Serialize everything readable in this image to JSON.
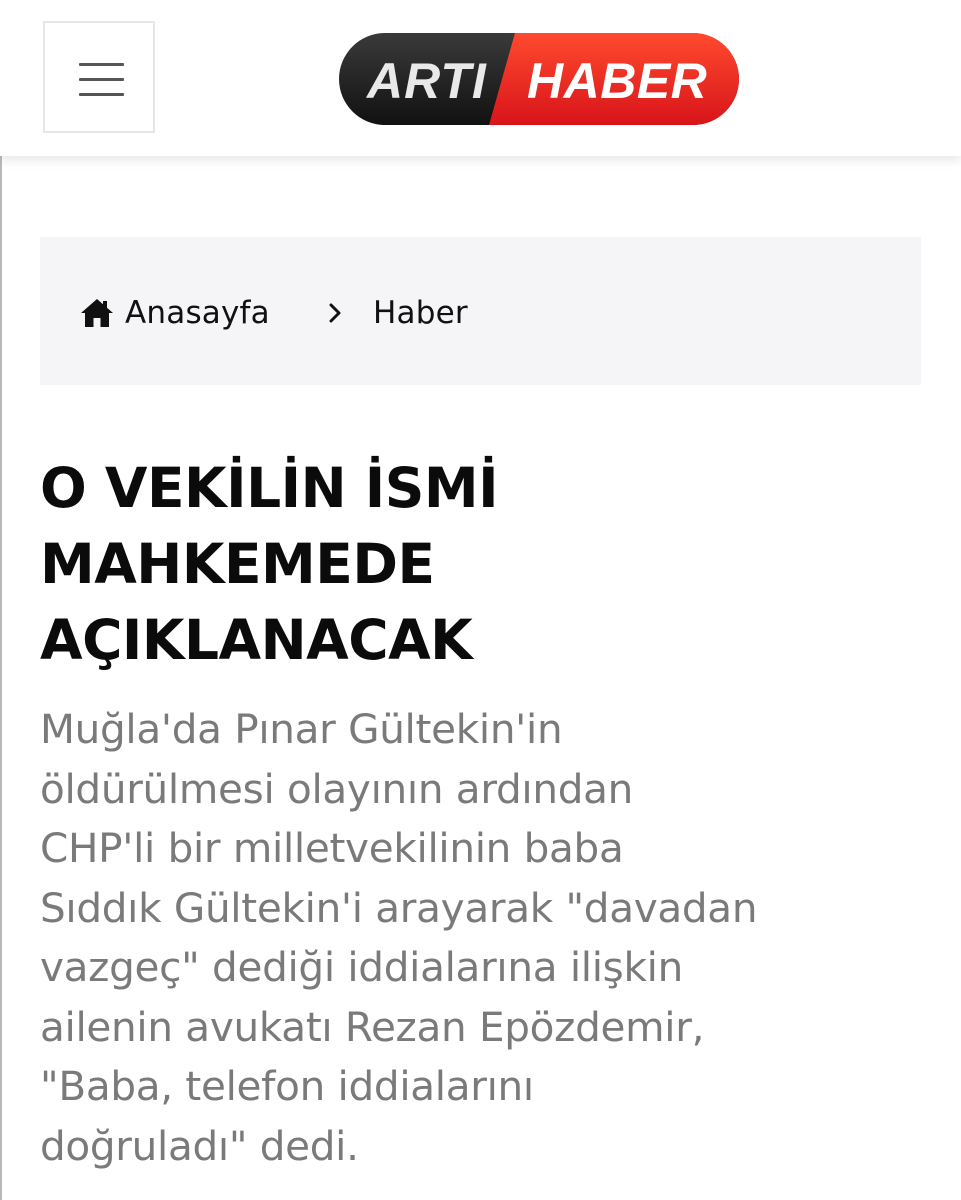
{
  "header": {
    "menu_icon": "hamburger-icon",
    "logo": {
      "part1": "ARTI",
      "part2": "HABER",
      "colors": {
        "dark": "#1c1c1c",
        "red": "#e8231f",
        "text": "#ffffff"
      }
    }
  },
  "breadcrumb": {
    "home_icon": "home-icon",
    "home_label": "Anasayfa",
    "separator_icon": "chevron-right-icon",
    "current_label": "Haber"
  },
  "article": {
    "headline_lines": [
      "O VEKİLİN İSMİ",
      "MAHKEMEDE",
      "AÇIKLANACAK"
    ],
    "summary_lines": [
      "Muğla'da Pınar Gültekin'in",
      "öldürülmesi olayının ardından",
      "CHP'li bir milletvekilinin baba",
      "Sıddık Gültekin'i arayarak \"davadan",
      "vazgeç\" dediği iddialarına ilişkin",
      "ailenin avukatı Rezan Epözdemir,",
      "\"Baba, telefon iddialarını",
      "doğruladı\" dedi."
    ]
  }
}
